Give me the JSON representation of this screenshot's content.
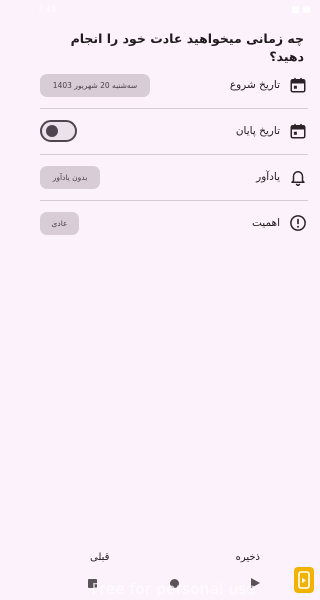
{
  "status_bar": {
    "time": "3:43"
  },
  "question": "چه زمانی میخواهید عادت خود را انجام دهید؟",
  "rows": [
    {
      "label": "تاریخ شروع",
      "icon": "calendar-icon",
      "value": "سه‌شنبه  20  شهریور  1403"
    },
    {
      "label": "تاریخ پایان",
      "icon": "calendar-icon",
      "toggle_on": true
    },
    {
      "label": "یادآور",
      "icon": "bell-icon",
      "value": "بدون یادآور"
    },
    {
      "label": "اهمیت",
      "icon": "alert-icon",
      "value": "عادی"
    }
  ],
  "actions": {
    "save": "ذخیره",
    "previous": "قبلی"
  },
  "watermark": "Free for personal use",
  "colors": {
    "background": "#fcf2fb",
    "chip": "#d8ccd6",
    "accent": "#4d4650",
    "divider": "#d5ccd2"
  }
}
